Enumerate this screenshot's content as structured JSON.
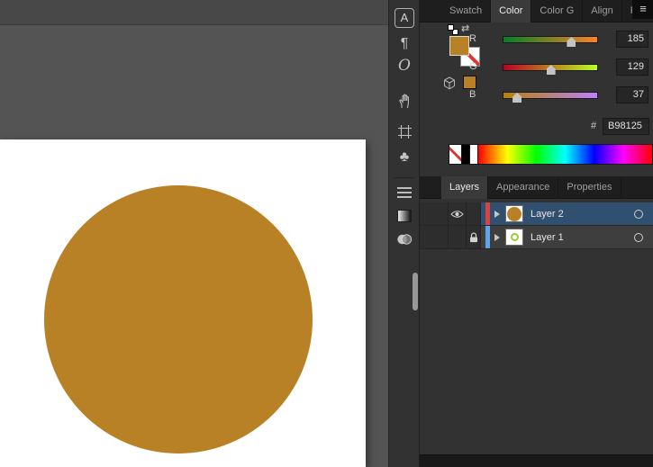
{
  "canvas": {
    "artwork_fill": "#B98125"
  },
  "tool_strip": {
    "character_glyph": "A",
    "paragraph_glyph": "¶",
    "opentype_glyph": "O",
    "symbols_glyph": "♣"
  },
  "panel_tabs_top": {
    "items": [
      {
        "label": "Swatch"
      },
      {
        "label": "Color"
      },
      {
        "label": "Color G"
      },
      {
        "label": "Align"
      },
      {
        "label": "Pathfin"
      }
    ],
    "menu_glyph": "≡"
  },
  "color_panel": {
    "swap_glyph": "⇄",
    "fill_hex": "#B98125",
    "sliders": [
      {
        "label": "R",
        "value": "185",
        "pos": "72.5%",
        "track": "linear-gradient(to right, rgb(0,129,37), rgb(255,129,37))"
      },
      {
        "label": "G",
        "value": "129",
        "pos": "50.6%",
        "track": "linear-gradient(to right, rgb(185,0,37), rgb(185,255,37))"
      },
      {
        "label": "B",
        "value": "37",
        "pos": "14.5%",
        "track": "linear-gradient(to right, rgb(185,129,0), rgb(185,129,255))"
      }
    ],
    "hex_prefix": "#",
    "hex_value": "B98125"
  },
  "layers_tabs": {
    "items": [
      {
        "label": "Layers"
      },
      {
        "label": "Appearance"
      },
      {
        "label": "Properties"
      }
    ]
  },
  "layers_panel": {
    "rows": [
      {
        "name": "Layer 2",
        "selected": true,
        "visible": true,
        "locked": false,
        "accent": "#D64541",
        "thumb_fill": "#B98125"
      },
      {
        "name": "Layer 1",
        "selected": false,
        "visible": false,
        "locked": true,
        "accent": "#5FA3E8",
        "thumb_ring": "#9ACD32"
      }
    ]
  }
}
